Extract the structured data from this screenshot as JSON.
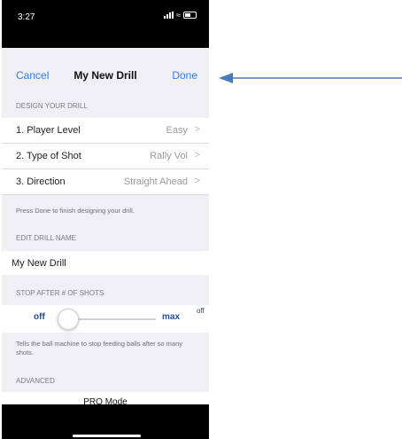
{
  "status": {
    "time": "3:27"
  },
  "nav": {
    "cancel": "Cancel",
    "title": "My New Drill",
    "done": "Done"
  },
  "design": {
    "header": "DESIGN YOUR DRILL",
    "rows": [
      {
        "label": "1. Player Level",
        "value": "Easy"
      },
      {
        "label": "2. Type of Shot",
        "value": "Rally Vol"
      },
      {
        "label": "3. Direction",
        "value": "Straight Ahead"
      }
    ],
    "note": "Press Done to finish designing your drill."
  },
  "edit_name": {
    "header": "EDIT DRILL NAME",
    "value": "My New Drill"
  },
  "stop": {
    "header": "STOP AFTER # OF SHOTS",
    "min_label": "off",
    "max_label": "max",
    "value_label": "off",
    "slider_value": 0,
    "note": "Tells the ball machine to stop feeding balls after so many shots."
  },
  "advanced": {
    "header": "ADVANCED",
    "pro_mode": "PRO Mode"
  },
  "colors": {
    "accent": "#2f7bf5",
    "slider_label": "#2b4a8c",
    "arrow": "#4a7ab8"
  }
}
